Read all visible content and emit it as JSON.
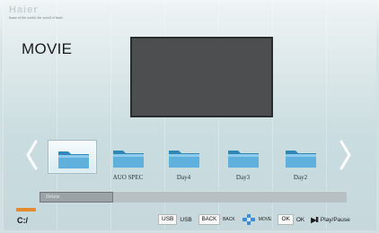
{
  "brand": {
    "logo": "Haier",
    "tagline": "home of the world, the world of haier"
  },
  "page": {
    "title": "MOVIE",
    "path": "C:/"
  },
  "folders": [
    {
      "label": "",
      "selected": true
    },
    {
      "label": "AUO SPEC",
      "selected": false
    },
    {
      "label": "Day4",
      "selected": false
    },
    {
      "label": "Day3",
      "selected": false
    },
    {
      "label": "Day2",
      "selected": false
    }
  ],
  "status": {
    "delete_label": "Delete"
  },
  "hints": {
    "usb_key": "USB",
    "usb_text": "USB",
    "back_key": "BACK",
    "back_text": "BACK",
    "move_text": "MOVE",
    "ok_key": "OK",
    "ok_text": "OK",
    "play_key": "▶II",
    "play_text": "Play/Pause"
  },
  "icons": {
    "left": "chevron-left-icon",
    "right": "chevron-right-icon",
    "folder": "folder-icon",
    "move": "dpad-move-icon",
    "play": "play-pause-icon"
  },
  "colors": {
    "accent_orange": "#e58a2e",
    "preview_bg": "#4c4e50",
    "folder_blue": "#4a9ec9"
  }
}
